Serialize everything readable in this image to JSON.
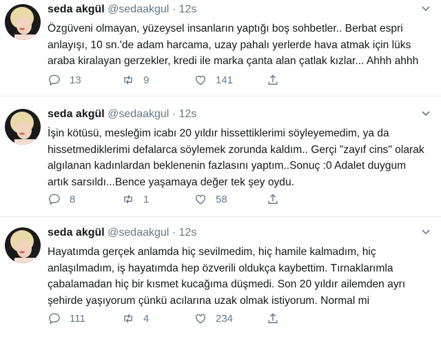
{
  "tweets": [
    {
      "name": "seda akgül",
      "handle": "@sedaakgul",
      "dot": "·",
      "time": "12s",
      "lines": [
        "Özgüveni olmayan, yüzeysel insanların yaptığı boş sohbetler.. Berbat espri",
        "anlayışı, 10 sn.'de adam harcama, uzay pahalı yerlerde hava atmak için lüks",
        "araba kiralayan gerzekler, kredi ile marka çanta alan çatlak kızlar... Ahhh ahhh"
      ],
      "replies": "13",
      "retweets": "9",
      "likes": "141"
    },
    {
      "name": "seda akgül",
      "handle": "@sedaakgul",
      "dot": "·",
      "time": "12s",
      "lines": [
        "İşin kötüsü, mesleğim icabı 20 yıldır hissettiklerimi söyleyemedim, ya da",
        "hissetmediklerimi defalarca söylemek zorunda kaldım.. Gerçi \"zayıf cins\" olarak",
        "algılanan kadınlardan beklenenin  fazlasını yaptım..Sonuç :0 Adalet duygum",
        "artık sarsıldı...Bence yaşamaya değer tek şey oydu."
      ],
      "replies": "8",
      "retweets": "1",
      "likes": "58"
    },
    {
      "name": "seda akgül",
      "handle": "@sedaakgul",
      "dot": "·",
      "time": "12s",
      "lines": [
        "Hayatımda gerçek anlamda hiç sevilmedim, hiç hamile kalmadım, hiç",
        "anlaşılmadım, iş hayatımda hep özverili oldukça kaybettim. Tırnaklarımla",
        "çabalamadan  hiç bir kısmet kucağıma düşmedi. Son 20  yıldır ailemden ayrı",
        "şehirde yaşıyorum çünkü acılarına uzak olmak istiyorum. Normal mi"
      ],
      "replies": "111",
      "retweets": "4",
      "likes": "234"
    }
  ],
  "icons": {
    "reply": "reply-icon",
    "retweet": "retweet-icon",
    "like": "like-icon",
    "share": "share-icon",
    "menu": "chevron-down-icon"
  },
  "colors": {
    "icon": "#657786",
    "text": "#14171a",
    "divider": "#e6ecf0"
  }
}
